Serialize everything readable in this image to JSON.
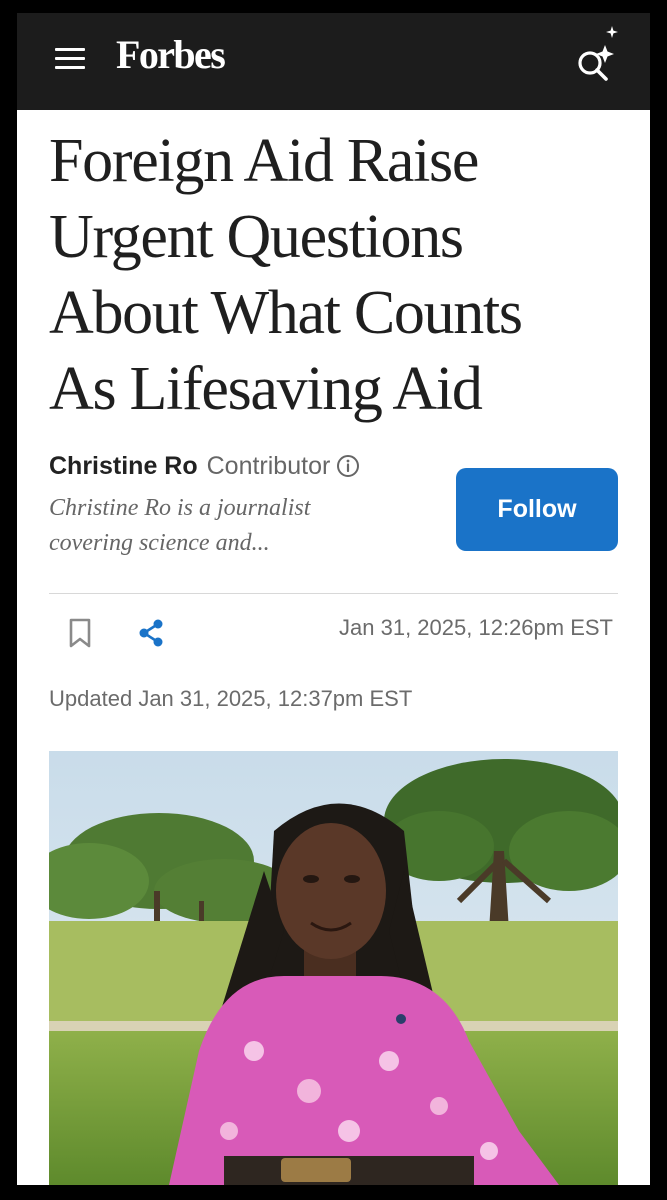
{
  "header": {
    "brand": "Forbes",
    "menu_icon": "hamburger-menu-icon",
    "search_icon": "sparkle-search-icon",
    "background": "#1c1c1c"
  },
  "article": {
    "headline_lines": [
      "Foreign Aid Raise",
      "Urgent Questions",
      "About What Counts",
      "As Lifesaving Aid"
    ],
    "author": {
      "name": "Christine Ro",
      "role": "Contributor",
      "bio_lines": [
        "Christine Ro is a journalist",
        "covering science and..."
      ],
      "info_icon": "info-icon"
    },
    "follow_label": "Follow",
    "follow_color": "#1a73c8",
    "actions": {
      "bookmark_icon": "bookmark-icon",
      "share_icon": "share-icon",
      "share_color": "#1a73c8"
    },
    "published": "Jan 31, 2025,  12:26pm EST",
    "updated_prefix": "Updated",
    "updated_date": "Jan 31, 2025, 12:37pm EST"
  }
}
